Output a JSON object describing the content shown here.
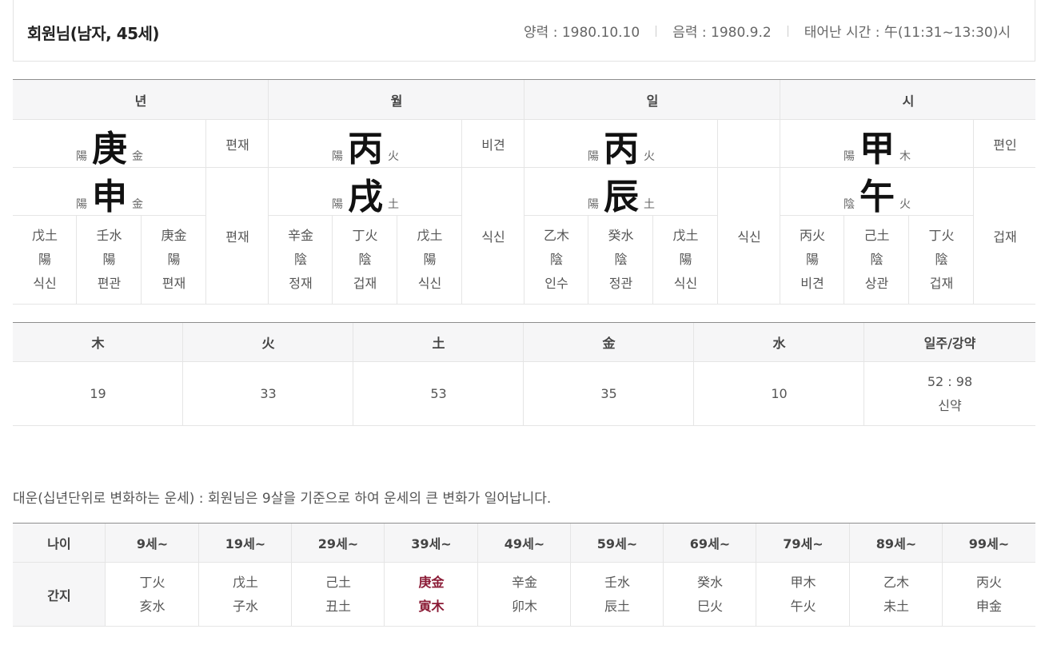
{
  "header": {
    "name": "회원님(남자, 45세)",
    "solar": "양력 : 1980.10.10",
    "lunar": "음력 : 1980.9.2",
    "birth_time": "태어난 시간 : 午(11:31~13:30)시"
  },
  "saju": {
    "columns": [
      {
        "label": "년",
        "stem": {
          "yinyang": "陽",
          "char": "庚",
          "element": "金",
          "ten_god": "편재"
        },
        "branch": {
          "yinyang": "陽",
          "char": "申",
          "element": "金",
          "ten_god": "편재"
        },
        "hidden": [
          {
            "char": "戊土",
            "yinyang": "陽",
            "ten_god": "식신"
          },
          {
            "char": "壬水",
            "yinyang": "陽",
            "ten_god": "편관"
          },
          {
            "char": "庚金",
            "yinyang": "陽",
            "ten_god": "편재"
          }
        ]
      },
      {
        "label": "월",
        "stem": {
          "yinyang": "陽",
          "char": "丙",
          "element": "火",
          "ten_god": "비견"
        },
        "branch": {
          "yinyang": "陽",
          "char": "戌",
          "element": "土",
          "ten_god": "식신"
        },
        "hidden": [
          {
            "char": "辛金",
            "yinyang": "陰",
            "ten_god": "정재"
          },
          {
            "char": "丁火",
            "yinyang": "陰",
            "ten_god": "겁재"
          },
          {
            "char": "戊土",
            "yinyang": "陽",
            "ten_god": "식신"
          }
        ]
      },
      {
        "label": "일",
        "stem": {
          "yinyang": "陽",
          "char": "丙",
          "element": "火",
          "ten_god": ""
        },
        "branch": {
          "yinyang": "陽",
          "char": "辰",
          "element": "土",
          "ten_god": "식신"
        },
        "hidden": [
          {
            "char": "乙木",
            "yinyang": "陰",
            "ten_god": "인수"
          },
          {
            "char": "癸水",
            "yinyang": "陰",
            "ten_god": "정관"
          },
          {
            "char": "戊土",
            "yinyang": "陽",
            "ten_god": "식신"
          }
        ]
      },
      {
        "label": "시",
        "stem": {
          "yinyang": "陽",
          "char": "甲",
          "element": "木",
          "ten_god": "편인"
        },
        "branch": {
          "yinyang": "陰",
          "char": "午",
          "element": "火",
          "ten_god": "겁재"
        },
        "hidden": [
          {
            "char": "丙火",
            "yinyang": "陽",
            "ten_god": "비견"
          },
          {
            "char": "己土",
            "yinyang": "陰",
            "ten_god": "상관"
          },
          {
            "char": "丁火",
            "yinyang": "陰",
            "ten_god": "겁재"
          }
        ]
      }
    ]
  },
  "elements": {
    "headers": [
      "木",
      "火",
      "土",
      "金",
      "水",
      "일주/강약"
    ],
    "values": [
      "19",
      "33",
      "53",
      "35",
      "10"
    ],
    "strength_ratio": "52 : 98",
    "strength_label": "신약"
  },
  "daeun": {
    "caption": "대운(십년단위로 변화하는 운세) : 회원님은 9살을 기준으로 하여 운세의 큰 변화가 일어납니다.",
    "age_label": "나이",
    "ganji_label": "간지",
    "periods": [
      {
        "age": "9세~",
        "stem": "丁火",
        "branch": "亥水",
        "highlight": false
      },
      {
        "age": "19세~",
        "stem": "戊土",
        "branch": "子水",
        "highlight": false
      },
      {
        "age": "29세~",
        "stem": "己土",
        "branch": "丑土",
        "highlight": false
      },
      {
        "age": "39세~",
        "stem": "庚金",
        "branch": "寅木",
        "highlight": true
      },
      {
        "age": "49세~",
        "stem": "辛金",
        "branch": "卯木",
        "highlight": false
      },
      {
        "age": "59세~",
        "stem": "壬水",
        "branch": "辰土",
        "highlight": false
      },
      {
        "age": "69세~",
        "stem": "癸水",
        "branch": "巳火",
        "highlight": false
      },
      {
        "age": "79세~",
        "stem": "甲木",
        "branch": "午火",
        "highlight": false
      },
      {
        "age": "89세~",
        "stem": "乙木",
        "branch": "未土",
        "highlight": false
      },
      {
        "age": "99세~",
        "stem": "丙火",
        "branch": "申金",
        "highlight": false
      }
    ]
  },
  "colors": {
    "highlight_red": "#8a1a35",
    "header_bg": "#f6f6f7"
  }
}
